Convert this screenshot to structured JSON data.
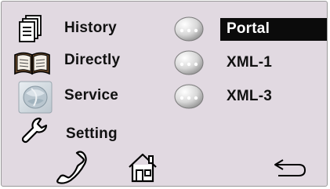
{
  "menu_left": [
    {
      "label": "History",
      "icon": "history-document-icon"
    },
    {
      "label": "Directly",
      "icon": "open-book-icon"
    },
    {
      "label": "Service",
      "icon": "service-globe-icon"
    },
    {
      "label": "Setting",
      "icon": "wrench-icon"
    }
  ],
  "menu_right": [
    {
      "label": "Portal",
      "icon": "dots-ball-icon",
      "selected": true
    },
    {
      "label": "XML-1",
      "icon": "dots-ball-icon"
    },
    {
      "label": "XML-3",
      "icon": "dots-ball-icon"
    }
  ],
  "softkeys": [
    {
      "icon": "phone-handset-icon"
    },
    {
      "icon": "home-icon"
    },
    {
      "icon": "back-arrow-icon"
    }
  ],
  "colors": {
    "background": "#e1d9e1",
    "selected_bg": "#0b0b0b",
    "text": "#111111"
  }
}
